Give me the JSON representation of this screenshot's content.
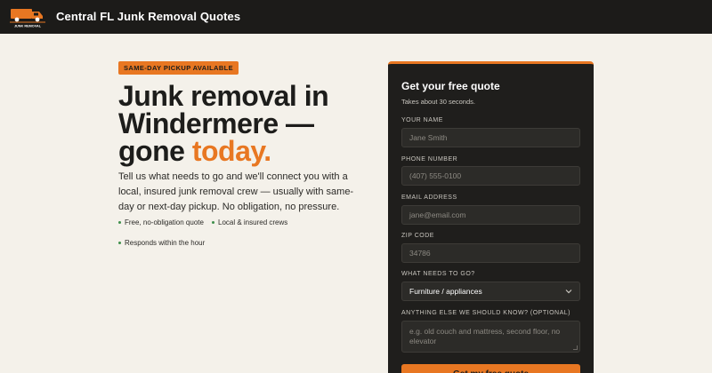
{
  "header": {
    "brand": "Central FL Junk Removal Quotes",
    "logo_text": "JUNK REMOVAL",
    "logo_icon": "truck-icon"
  },
  "hero": {
    "badge": "SAME-DAY PICKUP AVAILABLE",
    "headline_line1": "Junk removal in",
    "headline_line2": "Windermere —",
    "headline_line3_plain": "gone ",
    "headline_line3_accent": "today.",
    "lede": "Tell us what needs to go and we'll connect you with a local, insured junk removal crew — usually with same-day or next-day pickup. No obligation, no pressure.",
    "bullets": [
      "Free, no-obligation quote",
      "Local & insured crews",
      "Responds within the hour"
    ]
  },
  "form": {
    "title": "Get your free quote",
    "subtitle": "Takes about 30 seconds.",
    "name_label": "YOUR NAME",
    "name_placeholder": "Jane Smith",
    "phone_label": "PHONE NUMBER",
    "phone_placeholder": "(407) 555-0100",
    "email_label": "EMAIL ADDRESS",
    "email_placeholder": "jane@email.com",
    "zip_label": "ZIP CODE",
    "zip_placeholder": "34786",
    "items_label": "WHAT NEEDS TO GO?",
    "items_selected": "Furniture / appliances",
    "notes_label": "ANYTHING ELSE WE SHOULD KNOW? (OPTIONAL)",
    "notes_placeholder": "e.g. old couch and mattress, second floor, no elevator",
    "submit_label": "Get my free quote"
  },
  "colors": {
    "accent": "#e87722",
    "dark": "#1c1b19",
    "background": "#f4f1ea",
    "bullet_dot": "#3e8f4b"
  }
}
